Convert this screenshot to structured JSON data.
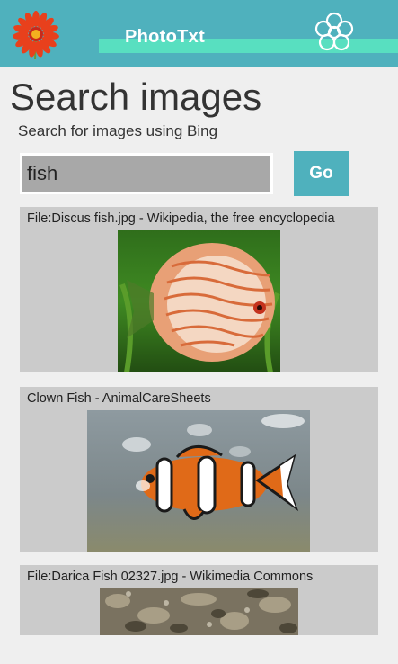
{
  "header": {
    "app_title": "PhotoTxt",
    "logo_icon": "gerbera-flower-icon",
    "settings_icon": "flower-outline-icon",
    "colors": {
      "bar": "#4fb1bd",
      "strip": "#58dfc0"
    }
  },
  "page": {
    "title": "Search images",
    "subtitle": "Search for images using Bing"
  },
  "search": {
    "value": "fish",
    "go_label": "Go"
  },
  "results": [
    {
      "title": "File:Discus fish.jpg - Wikipedia, the free encyclopedia"
    },
    {
      "title": "Clown Fish - AnimalCareSheets"
    },
    {
      "title": "File:Darica Fish 02327.jpg - Wikimedia Commons"
    }
  ]
}
